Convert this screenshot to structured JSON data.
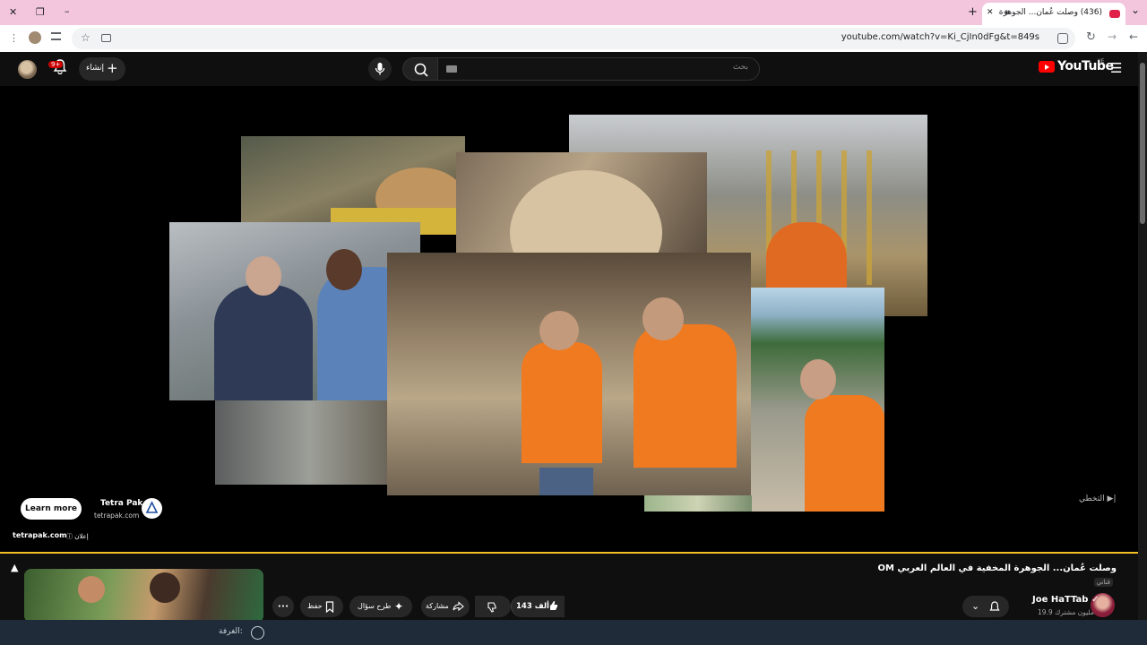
{
  "browser": {
    "tab_title": "(436) وصلت عُمان... الجوهرة",
    "url": "youtube.com/watch?v=Ki_CjIn0dFg&t=849s",
    "close_symbol": "✕",
    "restore_symbol": "❐",
    "minimize_symbol": "–",
    "newtab_symbol": "+",
    "tab_close_symbol": "✕",
    "tab_dropdown_symbol": "⌄",
    "menu_symbol": "⋮",
    "star_symbol": "☆",
    "reload_symbol": "↻",
    "back_symbol": "←",
    "forward_symbol": "→",
    "tab_audio_symbol": "◈"
  },
  "youtube": {
    "create_label": "إنشاء",
    "create_symbol": "+",
    "notifications_badge": "9+",
    "search_placeholder": "بحث",
    "logo_text": "YouTube",
    "region": "YE",
    "menu_symbol": "☰"
  },
  "ad": {
    "learn_more": "Learn more",
    "advertiser": "Tetra Pak",
    "advertiser_domain": "tetrapak.com",
    "display_domain": "tetrapak.com",
    "ad_label": "ⓘ إعلان",
    "skip_label": "التخطي ▶|"
  },
  "video": {
    "title": "وصلت عُمان... الجوهرة المخفية في العالم العربي OM",
    "badge": "قناتي",
    "channel_name": "Joe HaTTab ✓",
    "subscribers": "19.9 مليون مشترك",
    "likes": "143 ألف",
    "share_label": "مشاركة",
    "ask_label": "طرح سؤال",
    "save_label": "حفظ",
    "more_symbol": "•••"
  },
  "status_bar": {
    "room_label": "الغرفة:"
  },
  "colors": {
    "progress": "#f2bf24",
    "brand_red": "#ff0000",
    "tabstrip": "#f3c6dd"
  }
}
